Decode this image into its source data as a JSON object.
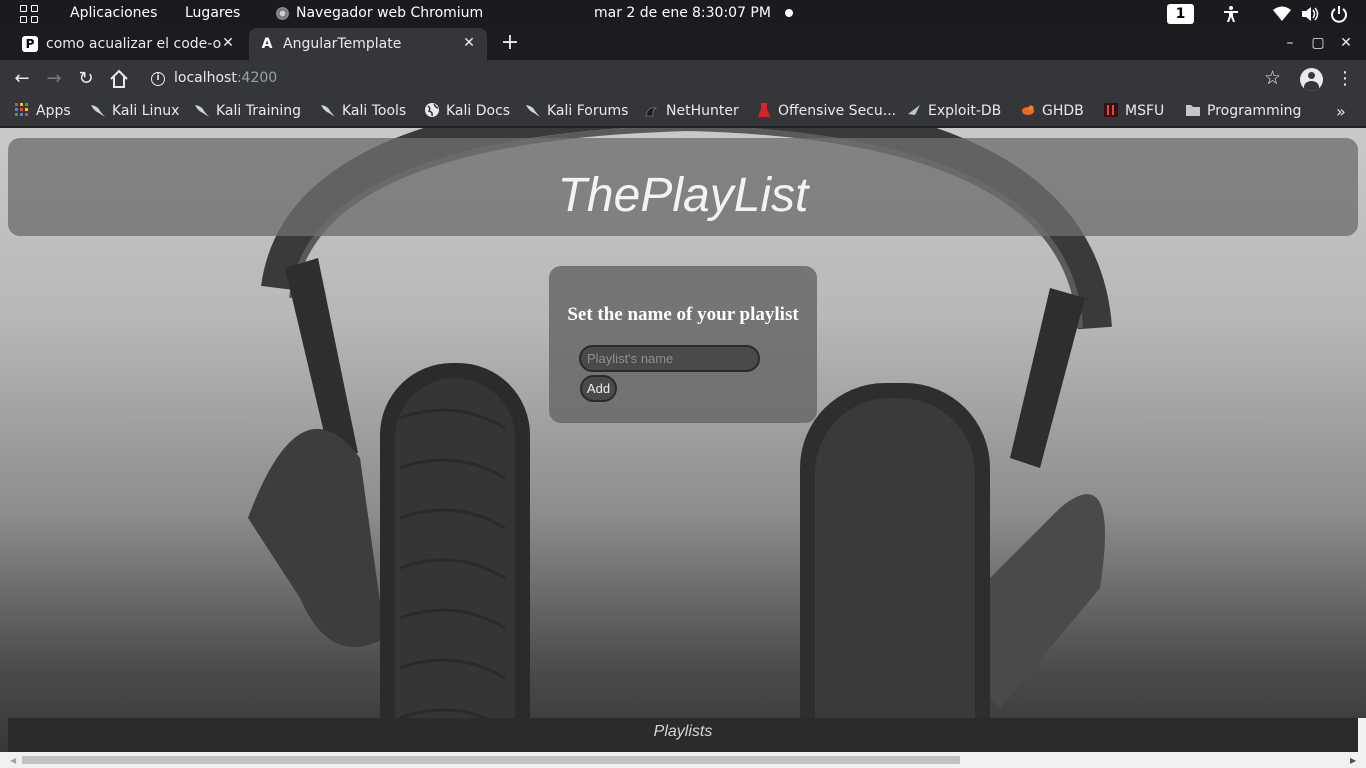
{
  "topbar": {
    "applications": "Aplicaciones",
    "places": "Lugares",
    "active_app": "Navegador web Chromium",
    "date": "mar  2 de ene",
    "time": "8:30:07 PM",
    "workspace": "1"
  },
  "tabs": [
    {
      "label": "como acualizar el code-oss",
      "favicon": "P",
      "active": false
    },
    {
      "label": "AngularTemplate",
      "favicon": "A",
      "active": true
    }
  ],
  "window_controls": {
    "minimize": "–",
    "maximize": "▢",
    "close": "✕"
  },
  "address_bar": {
    "host": "localhost",
    "port": ":4200"
  },
  "bookmarks": [
    {
      "label": "Apps",
      "icon": "apps-grid-icon"
    },
    {
      "label": "Kali Linux",
      "icon": "kali-dragon-icon"
    },
    {
      "label": "Kali Training",
      "icon": "kali-dragon-icon"
    },
    {
      "label": "Kali Tools",
      "icon": "kali-dragon-icon"
    },
    {
      "label": "Kali Docs",
      "icon": "globe-icon"
    },
    {
      "label": "Kali Forums",
      "icon": "kali-dragon-icon"
    },
    {
      "label": "NetHunter",
      "icon": "nethunter-icon"
    },
    {
      "label": "Offensive Secu...",
      "icon": "offsec-icon"
    },
    {
      "label": "Exploit-DB",
      "icon": "exploitdb-icon"
    },
    {
      "label": "GHDB",
      "icon": "ghdb-icon"
    },
    {
      "label": "MSFU",
      "icon": "msfu-icon"
    },
    {
      "label": "Programming",
      "icon": "folder-icon"
    }
  ],
  "page": {
    "site_title": "ThePlayList",
    "form_heading": "Set the name of your playlist",
    "input_placeholder": "Playlist's name",
    "input_value": "",
    "add_label": "Add",
    "footer_link": "Playlists"
  },
  "colors": {
    "chrome_dark": "#35363a",
    "topbar": "#1a1b1f",
    "panel": "#6e6e6e"
  }
}
